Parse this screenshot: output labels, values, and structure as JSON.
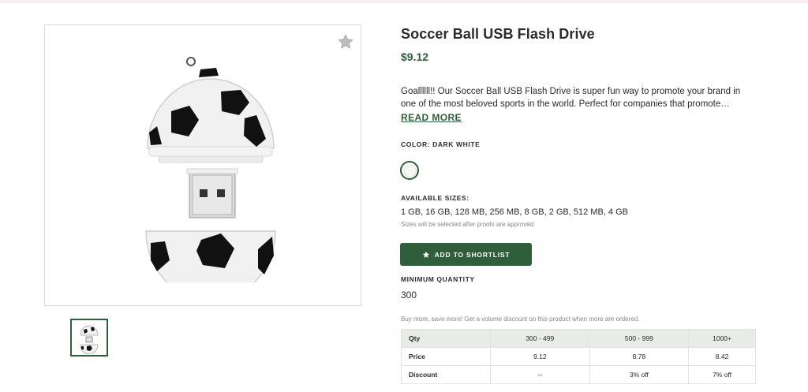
{
  "product": {
    "title": "Soccer Ball USB Flash Drive",
    "price": "$9.12",
    "description": "Goallllll!! Our Soccer Ball USB Flash Drive is super fun way to promote your brand in one of the most beloved sports in the world. Perfect for companies that promote…",
    "read_more_label": "READ MORE"
  },
  "color": {
    "label": "COLOR: DARK WHITE",
    "swatch_hex": "#f7f7f4"
  },
  "sizes": {
    "label": "AVAILABLE SIZES:",
    "values": "1 GB, 16 GB, 128 MB, 256 MB, 8 GB, 2 GB, 512 MB, 4 GB",
    "note": "Sizes will be selected after proofs are approved"
  },
  "shortlist_button": {
    "label": "ADD TO SHORTLIST",
    "icon": "star-icon"
  },
  "minimum_quantity": {
    "label": "MINIMUM QUANTITY",
    "value": "300"
  },
  "volume_note": "Buy more, save more! Get a volume discount on this product when more are ordered.",
  "pricing_table": {
    "headers": [
      "Qty",
      "300 - 499",
      "500 - 999",
      "1000+"
    ],
    "rows": [
      [
        "Price",
        "9.12",
        "8.78",
        "8.42"
      ],
      [
        "Discount",
        "--",
        "3% off",
        "7% off"
      ]
    ]
  },
  "icons": {
    "favorite": "star-outline-icon"
  },
  "colors": {
    "accent": "#2e5e3a",
    "table_header_bg": "#e7ece6"
  }
}
